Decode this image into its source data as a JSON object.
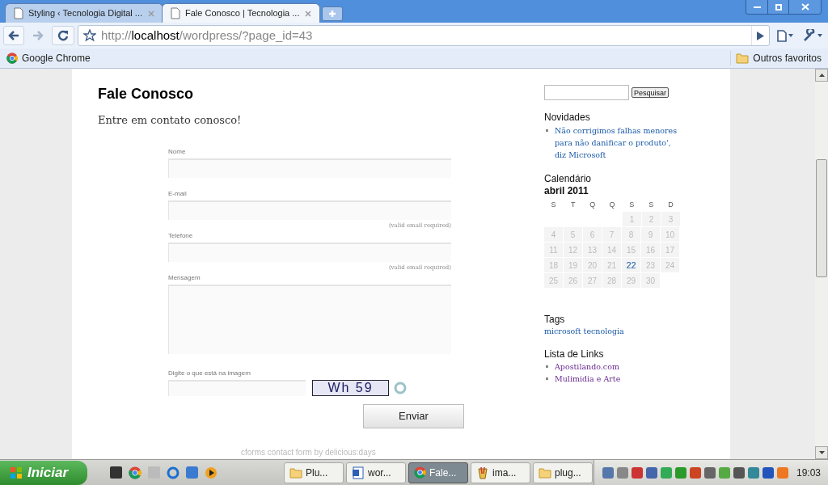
{
  "tabs": [
    {
      "title": "Styling ‹ Tecnologia Digital ...",
      "selected": false
    },
    {
      "title": "Fale Conosco | Tecnologia ...",
      "selected": true
    }
  ],
  "address": {
    "scheme": "http://",
    "host": "localhost",
    "path": "/wordpress/?page_id=43"
  },
  "bookmarks": [
    {
      "label": "Google Chrome",
      "kind": "chrome"
    }
  ],
  "other_bookmarks": "Outros favoritos",
  "page": {
    "title": "Fale Conosco",
    "intro": "Entre em contato conosco!",
    "fields": [
      {
        "label": "Nome",
        "kind": "input"
      },
      {
        "label": "E-mail",
        "kind": "input",
        "note": "(valid email required)"
      },
      {
        "label": "Telefone",
        "kind": "input",
        "note": "(valid email required)"
      },
      {
        "label": "Mensagem",
        "kind": "textarea"
      }
    ],
    "captcha": {
      "label": "Digite o que está na imagem",
      "code": "Wh 59"
    },
    "submit": "Enviar",
    "footer": "cforms contact form by delicious:days"
  },
  "sidebar": {
    "search_button": "Pesquisar",
    "news_title": "Novidades",
    "news": [
      "Não corrigimos falhas menores para não danificar o produto', diz Microsoft"
    ],
    "calendar_title": "Calendário",
    "month": "abril 2011",
    "weekdays": [
      "S",
      "T",
      "Q",
      "Q",
      "S",
      "S",
      "D"
    ],
    "weeks": [
      [
        {
          "d": "1",
          "link": false
        },
        {
          "d": "2",
          "link": false
        },
        {
          "d": "3",
          "link": false
        }
      ],
      [
        {
          "d": "4",
          "link": false
        },
        {
          "d": "5",
          "link": false
        },
        {
          "d": "6",
          "link": false
        },
        {
          "d": "7",
          "link": false
        },
        {
          "d": "8",
          "link": false
        },
        {
          "d": "9",
          "link": false
        },
        {
          "d": "10",
          "link": false
        }
      ],
      [
        {
          "d": "11",
          "link": false
        },
        {
          "d": "12",
          "link": false
        },
        {
          "d": "13",
          "link": false
        },
        {
          "d": "14",
          "link": false
        },
        {
          "d": "15",
          "link": false
        },
        {
          "d": "16",
          "link": false
        },
        {
          "d": "17",
          "link": false
        }
      ],
      [
        {
          "d": "18",
          "link": false
        },
        {
          "d": "19",
          "link": false
        },
        {
          "d": "20",
          "link": false
        },
        {
          "d": "21",
          "link": false
        },
        {
          "d": "22",
          "link": true
        },
        {
          "d": "23",
          "link": false
        },
        {
          "d": "24",
          "link": false
        }
      ],
      [
        {
          "d": "25",
          "link": false
        },
        {
          "d": "26",
          "link": false
        },
        {
          "d": "27",
          "link": false
        },
        {
          "d": "28",
          "link": false
        },
        {
          "d": "29",
          "link": false
        },
        {
          "d": "30",
          "link": false
        }
      ]
    ],
    "tags_title": "Tags",
    "tags": "microsoft tecnologia",
    "links_title": "Lista de Links",
    "links": [
      "Apostilando.com",
      "Mulimidia e Arte"
    ]
  },
  "taskbar": {
    "start": "Iniciar",
    "windows": [
      {
        "label": "Plu...",
        "kind": "folder",
        "selected": false
      },
      {
        "label": "wor...",
        "kind": "word",
        "selected": false
      },
      {
        "label": "Fale...",
        "kind": "chrome",
        "selected": true
      },
      {
        "label": "ima...",
        "kind": "paint",
        "selected": false
      },
      {
        "label": "plug...",
        "kind": "folder",
        "selected": false
      }
    ],
    "clock": "19:03"
  }
}
